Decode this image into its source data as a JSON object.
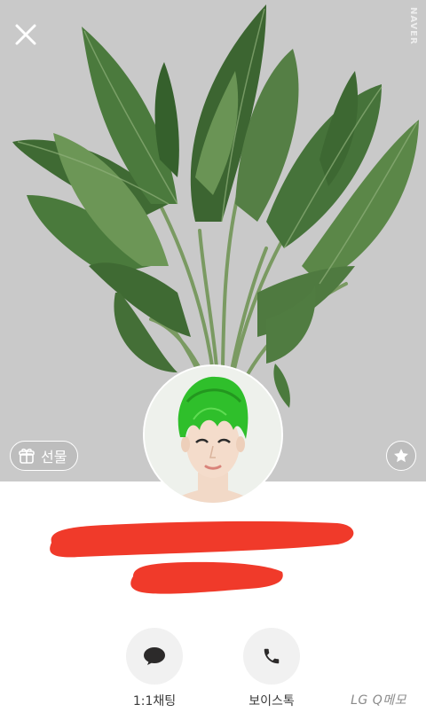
{
  "header": {
    "close_icon": "close-icon",
    "watermark_text": "NAVER"
  },
  "cover": {
    "background": "#c9c9c9",
    "subject": "spinach-leaves"
  },
  "buttons": {
    "gift_label": "선물",
    "gift_icon": "gift-icon",
    "favorite_icon": "star-icon"
  },
  "profile": {
    "name": "",
    "status": "",
    "redaction_color": "#f03a2a"
  },
  "actions": [
    {
      "label": "1:1채팅",
      "icon": "chat-bubble-icon"
    },
    {
      "label": "보이스톡",
      "icon": "phone-icon"
    }
  ],
  "footer": {
    "memo_watermark": "LG Q메모"
  },
  "colors": {
    "leaf_dark": "#3c6531",
    "leaf_mid": "#4f7a40",
    "leaf_light": "#6c9656",
    "hair_green": "#2fbf2b",
    "action_circle": "#f1f1f1"
  }
}
